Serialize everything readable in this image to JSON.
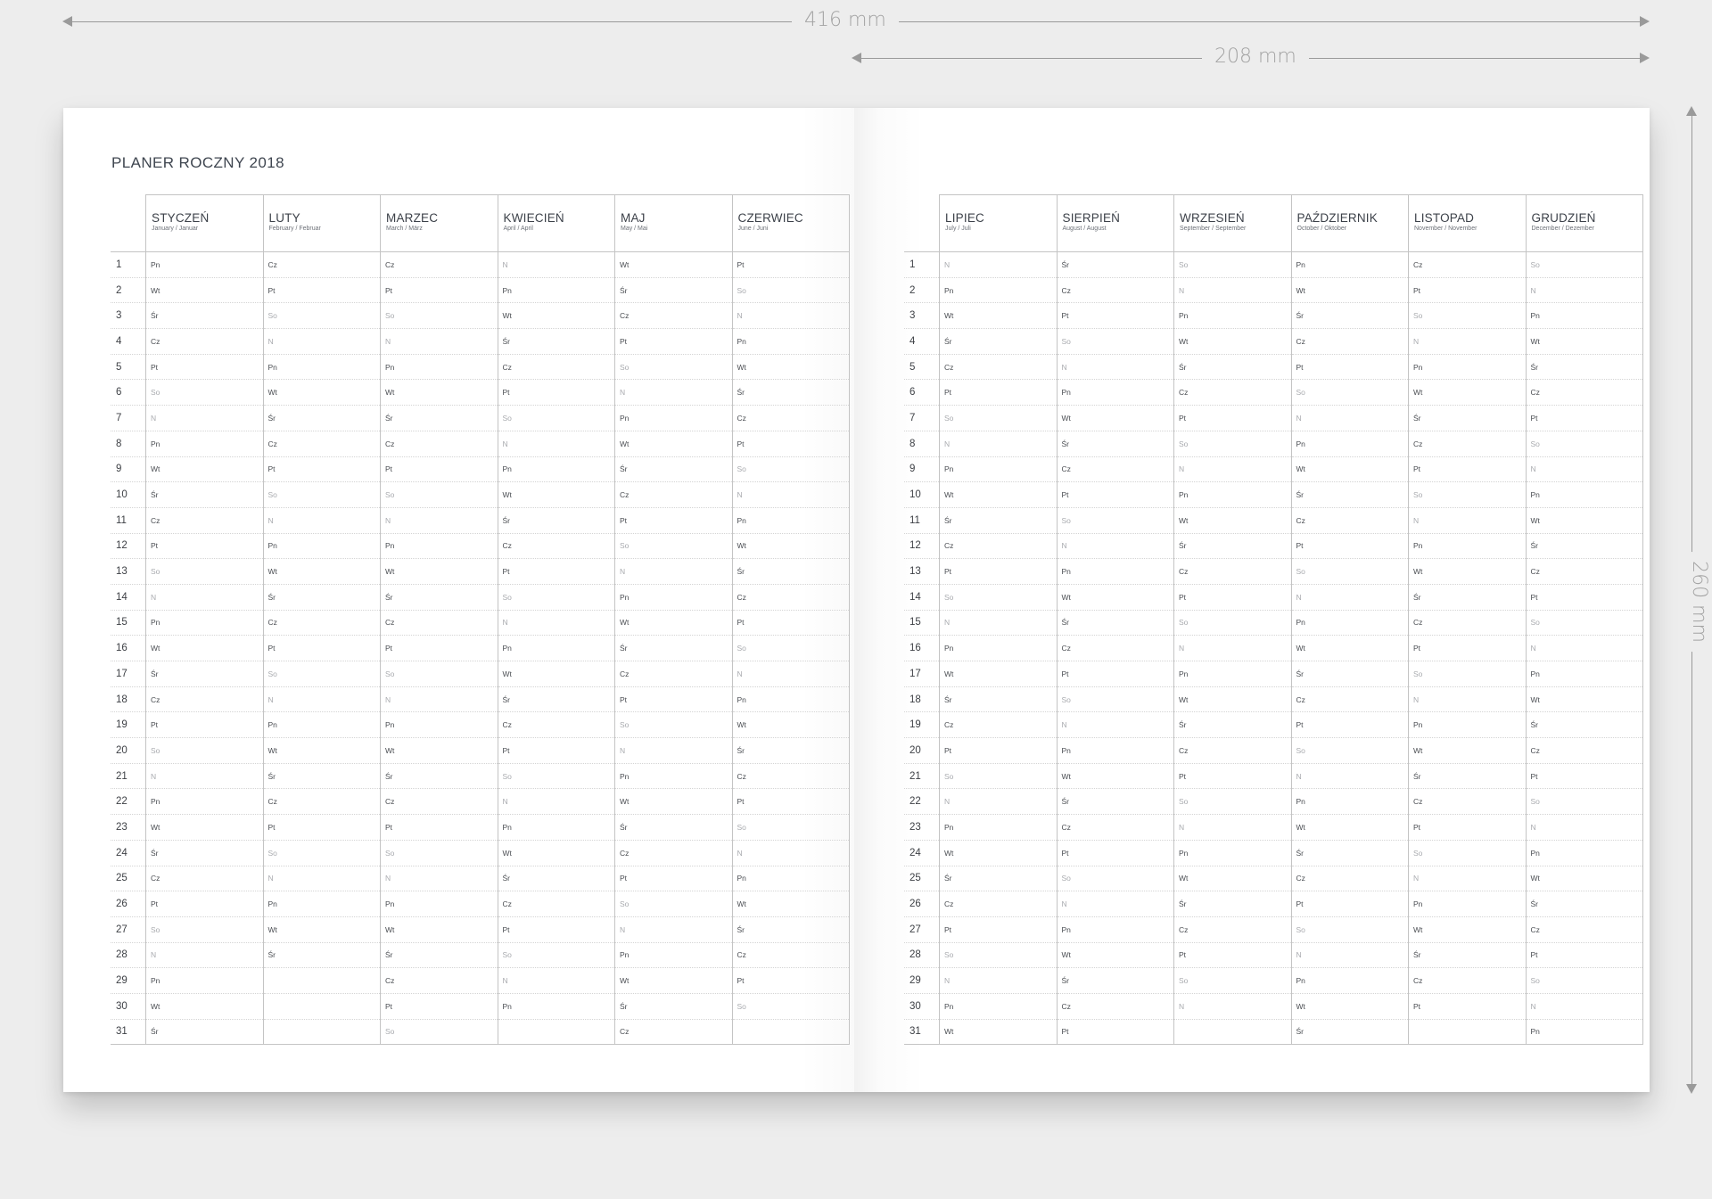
{
  "dimensions": {
    "width_label": "416 mm",
    "page_width_label": "208 mm",
    "height_label": "260 mm"
  },
  "planner_title": "PLANER ROCZNY 2018",
  "day_numbers": [
    "1",
    "2",
    "3",
    "4",
    "5",
    "6",
    "7",
    "8",
    "9",
    "10",
    "11",
    "12",
    "13",
    "14",
    "15",
    "16",
    "17",
    "18",
    "19",
    "20",
    "21",
    "22",
    "23",
    "24",
    "25",
    "26",
    "27",
    "28",
    "29",
    "30",
    "31"
  ],
  "weekend_labels": [
    "So",
    "N"
  ],
  "left_page": {
    "months": [
      {
        "name": "STYCZEŃ",
        "sub": "January / Januar",
        "days": [
          "Pn",
          "Wt",
          "Śr",
          "Cz",
          "Pt",
          "So",
          "N",
          "Pn",
          "Wt",
          "Śr",
          "Cz",
          "Pt",
          "So",
          "N",
          "Pn",
          "Wt",
          "Śr",
          "Cz",
          "Pt",
          "So",
          "N",
          "Pn",
          "Wt",
          "Śr",
          "Cz",
          "Pt",
          "So",
          "N",
          "Pn",
          "Wt",
          "Śr"
        ]
      },
      {
        "name": "LUTY",
        "sub": "February / Februar",
        "days": [
          "Cz",
          "Pt",
          "So",
          "N",
          "Pn",
          "Wt",
          "Śr",
          "Cz",
          "Pt",
          "So",
          "N",
          "Pn",
          "Wt",
          "Śr",
          "Cz",
          "Pt",
          "So",
          "N",
          "Pn",
          "Wt",
          "Śr",
          "Cz",
          "Pt",
          "So",
          "N",
          "Pn",
          "Wt",
          "Śr",
          "",
          "",
          ""
        ]
      },
      {
        "name": "MARZEC",
        "sub": "March / März",
        "days": [
          "Cz",
          "Pt",
          "So",
          "N",
          "Pn",
          "Wt",
          "Śr",
          "Cz",
          "Pt",
          "So",
          "N",
          "Pn",
          "Wt",
          "Śr",
          "Cz",
          "Pt",
          "So",
          "N",
          "Pn",
          "Wt",
          "Śr",
          "Cz",
          "Pt",
          "So",
          "N",
          "Pn",
          "Wt",
          "Śr",
          "Cz",
          "Pt",
          "So"
        ]
      },
      {
        "name": "KWIECIEŃ",
        "sub": "April / April",
        "days": [
          "N",
          "Pn",
          "Wt",
          "Śr",
          "Cz",
          "Pt",
          "So",
          "N",
          "Pn",
          "Wt",
          "Śr",
          "Cz",
          "Pt",
          "So",
          "N",
          "Pn",
          "Wt",
          "Śr",
          "Cz",
          "Pt",
          "So",
          "N",
          "Pn",
          "Wt",
          "Śr",
          "Cz",
          "Pt",
          "So",
          "N",
          "Pn",
          ""
        ]
      },
      {
        "name": "MAJ",
        "sub": "May / Mai",
        "days": [
          "Wt",
          "Śr",
          "Cz",
          "Pt",
          "So",
          "N",
          "Pn",
          "Wt",
          "Śr",
          "Cz",
          "Pt",
          "So",
          "N",
          "Pn",
          "Wt",
          "Śr",
          "Cz",
          "Pt",
          "So",
          "N",
          "Pn",
          "Wt",
          "Śr",
          "Cz",
          "Pt",
          "So",
          "N",
          "Pn",
          "Wt",
          "Śr",
          "Cz"
        ]
      },
      {
        "name": "CZERWIEC",
        "sub": "June / Juni",
        "days": [
          "Pt",
          "So",
          "N",
          "Pn",
          "Wt",
          "Śr",
          "Cz",
          "Pt",
          "So",
          "N",
          "Pn",
          "Wt",
          "Śr",
          "Cz",
          "Pt",
          "So",
          "N",
          "Pn",
          "Wt",
          "Śr",
          "Cz",
          "Pt",
          "So",
          "N",
          "Pn",
          "Wt",
          "Śr",
          "Cz",
          "Pt",
          "So",
          ""
        ]
      }
    ]
  },
  "right_page": {
    "months": [
      {
        "name": "LIPIEC",
        "sub": "July / Juli",
        "days": [
          "N",
          "Pn",
          "Wt",
          "Śr",
          "Cz",
          "Pt",
          "So",
          "N",
          "Pn",
          "Wt",
          "Śr",
          "Cz",
          "Pt",
          "So",
          "N",
          "Pn",
          "Wt",
          "Śr",
          "Cz",
          "Pt",
          "So",
          "N",
          "Pn",
          "Wt",
          "Śr",
          "Cz",
          "Pt",
          "So",
          "N",
          "Pn",
          "Wt"
        ]
      },
      {
        "name": "SIERPIEŃ",
        "sub": "August / August",
        "days": [
          "Śr",
          "Cz",
          "Pt",
          "So",
          "N",
          "Pn",
          "Wt",
          "Śr",
          "Cz",
          "Pt",
          "So",
          "N",
          "Pn",
          "Wt",
          "Śr",
          "Cz",
          "Pt",
          "So",
          "N",
          "Pn",
          "Wt",
          "Śr",
          "Cz",
          "Pt",
          "So",
          "N",
          "Pn",
          "Wt",
          "Śr",
          "Cz",
          "Pt"
        ]
      },
      {
        "name": "WRZESIEŃ",
        "sub": "September / September",
        "days": [
          "So",
          "N",
          "Pn",
          "Wt",
          "Śr",
          "Cz",
          "Pt",
          "So",
          "N",
          "Pn",
          "Wt",
          "Śr",
          "Cz",
          "Pt",
          "So",
          "N",
          "Pn",
          "Wt",
          "Śr",
          "Cz",
          "Pt",
          "So",
          "N",
          "Pn",
          "Wt",
          "Śr",
          "Cz",
          "Pt",
          "So",
          "N",
          ""
        ]
      },
      {
        "name": "PAŹDZIERNIK",
        "sub": "October / Oktober",
        "days": [
          "Pn",
          "Wt",
          "Śr",
          "Cz",
          "Pt",
          "So",
          "N",
          "Pn",
          "Wt",
          "Śr",
          "Cz",
          "Pt",
          "So",
          "N",
          "Pn",
          "Wt",
          "Śr",
          "Cz",
          "Pt",
          "So",
          "N",
          "Pn",
          "Wt",
          "Śr",
          "Cz",
          "Pt",
          "So",
          "N",
          "Pn",
          "Wt",
          "Śr"
        ]
      },
      {
        "name": "LISTOPAD",
        "sub": "November / November",
        "days": [
          "Cz",
          "Pt",
          "So",
          "N",
          "Pn",
          "Wt",
          "Śr",
          "Cz",
          "Pt",
          "So",
          "N",
          "Pn",
          "Wt",
          "Śr",
          "Cz",
          "Pt",
          "So",
          "N",
          "Pn",
          "Wt",
          "Śr",
          "Cz",
          "Pt",
          "So",
          "N",
          "Pn",
          "Wt",
          "Śr",
          "Cz",
          "Pt",
          ""
        ]
      },
      {
        "name": "GRUDZIEŃ",
        "sub": "December / Dezember",
        "days": [
          "So",
          "N",
          "Pn",
          "Wt",
          "Śr",
          "Cz",
          "Pt",
          "So",
          "N",
          "Pn",
          "Wt",
          "Śr",
          "Cz",
          "Pt",
          "So",
          "N",
          "Pn",
          "Wt",
          "Śr",
          "Cz",
          "Pt",
          "So",
          "N",
          "Pn",
          "Wt",
          "Śr",
          "Cz",
          "Pt",
          "So",
          "N",
          "Pn"
        ]
      }
    ]
  }
}
